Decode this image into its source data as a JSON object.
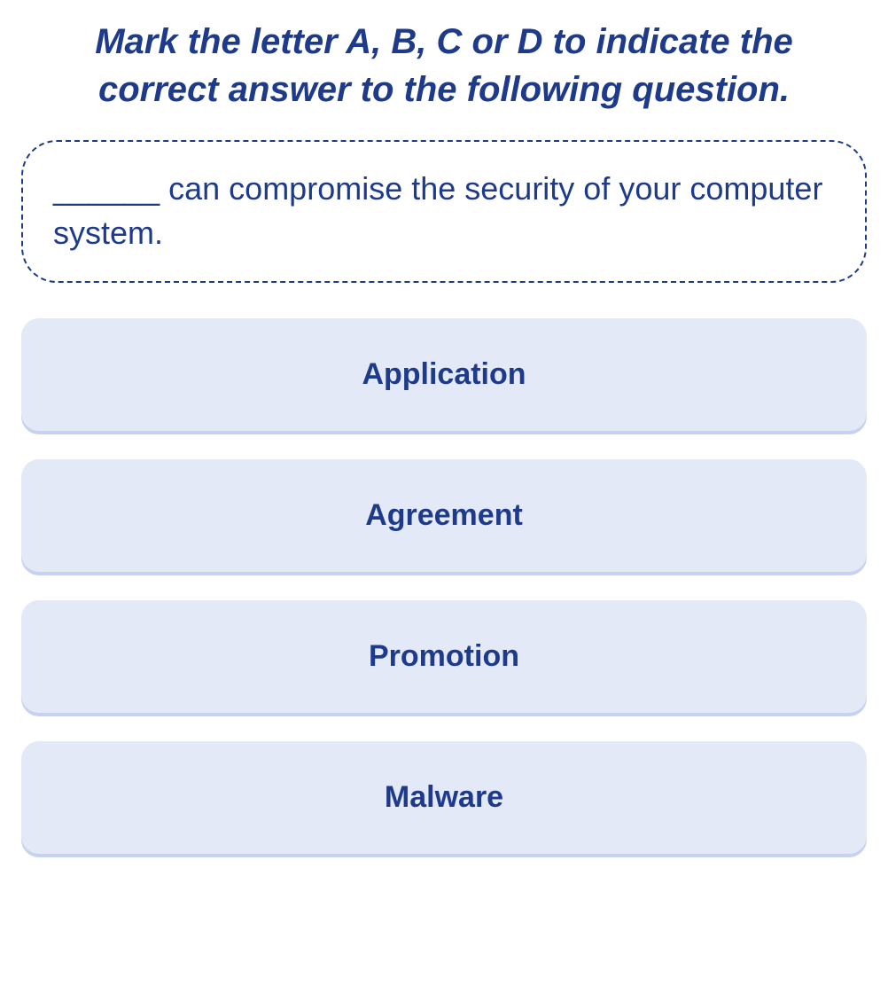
{
  "instruction": "Mark the letter A, B, C or D to indicate the correct answer to the following question.",
  "question": "______ can compromise the security of your computer system.",
  "options": [
    {
      "label": "Application"
    },
    {
      "label": "Agreement"
    },
    {
      "label": "Promotion"
    },
    {
      "label": "Malware"
    }
  ]
}
